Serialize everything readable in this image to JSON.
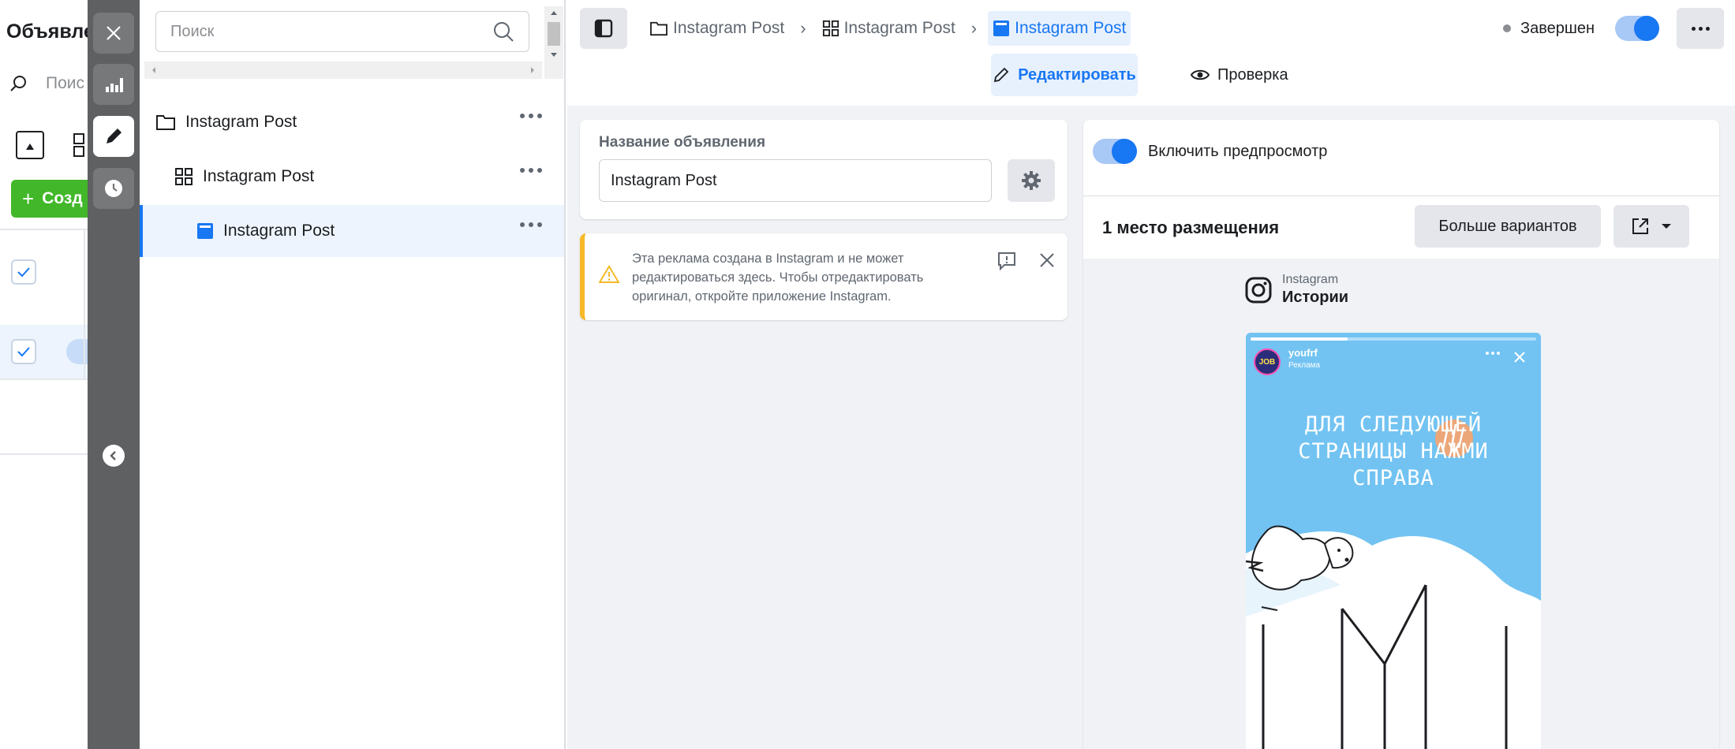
{
  "background_panel": {
    "title": "Объявле",
    "search_placeholder": "Поис",
    "create_button": "Созд"
  },
  "rail": {
    "close": "close-icon",
    "stats": "bar-chart-icon",
    "edit": "pencil-icon",
    "history": "clock-icon",
    "collapse": "chevron-left-icon"
  },
  "tree": {
    "search_placeholder": "Поиск",
    "items": [
      {
        "label": "Instagram Post",
        "icon": "folder-icon",
        "level": 0
      },
      {
        "label": "Instagram Post",
        "icon": "grid-icon",
        "level": 1
      },
      {
        "label": "Instagram Post",
        "icon": "ad-icon",
        "level": 2,
        "selected": true
      }
    ]
  },
  "header": {
    "breadcrumb": [
      {
        "label": "Instagram Post",
        "icon": "folder-icon"
      },
      {
        "label": "Instagram Post",
        "icon": "grid-icon"
      },
      {
        "label": "Instagram Post",
        "icon": "ad-icon",
        "active": true
      }
    ],
    "status_label": "Завершен",
    "status_enabled": true,
    "modes": {
      "edit": "Редактировать",
      "review": "Проверка"
    }
  },
  "editor": {
    "ad_name_label": "Название объявления",
    "ad_name_value": "Instagram Post",
    "warning_text": "Эта реклама создана в Instagram и не может редактироваться здесь. Чтобы отредактировать оригинал, откройте приложение Instagram."
  },
  "preview": {
    "enable_label": "Включить предпросмотр",
    "enabled": true,
    "placement_count": "1 место размещения",
    "more_options": "Больше вариантов",
    "platform": "Instagram",
    "placement": "Истории",
    "story": {
      "username": "youfrf",
      "sponsored": "Реклама",
      "avatar_text": "JOB",
      "caption_lines": [
        "Для следующей",
        "страницы нажми",
        "справа"
      ],
      "progress": 0.34
    }
  },
  "colors": {
    "accent": "#1877f2",
    "rail": "#5f6062",
    "warning": "#f7b928",
    "story_sky": "#72c3f2",
    "create_button": "#42b72a"
  }
}
